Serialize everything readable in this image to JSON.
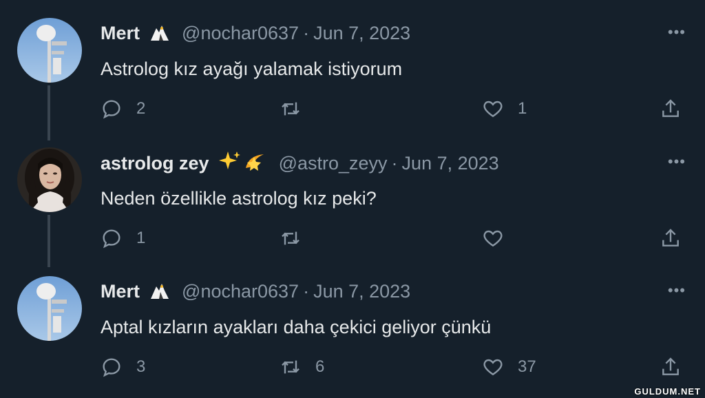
{
  "tweets": [
    {
      "name": "Mert",
      "badge": "eagle-emoji",
      "handle": "@nochar0637",
      "date": "Jun 7, 2023",
      "text": "Astrolog kız ayağı yalamak istiyorum",
      "replies": "2",
      "retweets": "",
      "likes": "1"
    },
    {
      "name": "astrolog zey",
      "badge": "sparkles-shooting-star-emoji",
      "handle": "@astro_zeyy",
      "date": "Jun 7, 2023",
      "text": "Neden özellikle astrolog kız peki?",
      "replies": "1",
      "retweets": "",
      "likes": ""
    },
    {
      "name": "Mert",
      "badge": "eagle-emoji",
      "handle": "@nochar0637",
      "date": "Jun 7, 2023",
      "text": "Aptal kızların ayakları daha çekici geliyor çünkü",
      "replies": "3",
      "retweets": "6",
      "likes": "37"
    }
  ],
  "separator": "·",
  "more_label": "•••",
  "watermark": "GULDUM.NET",
  "colors": {
    "background": "#15202b",
    "text_primary": "#e7e9ea",
    "text_secondary": "#8b98a5",
    "connector": "#3a4550"
  }
}
